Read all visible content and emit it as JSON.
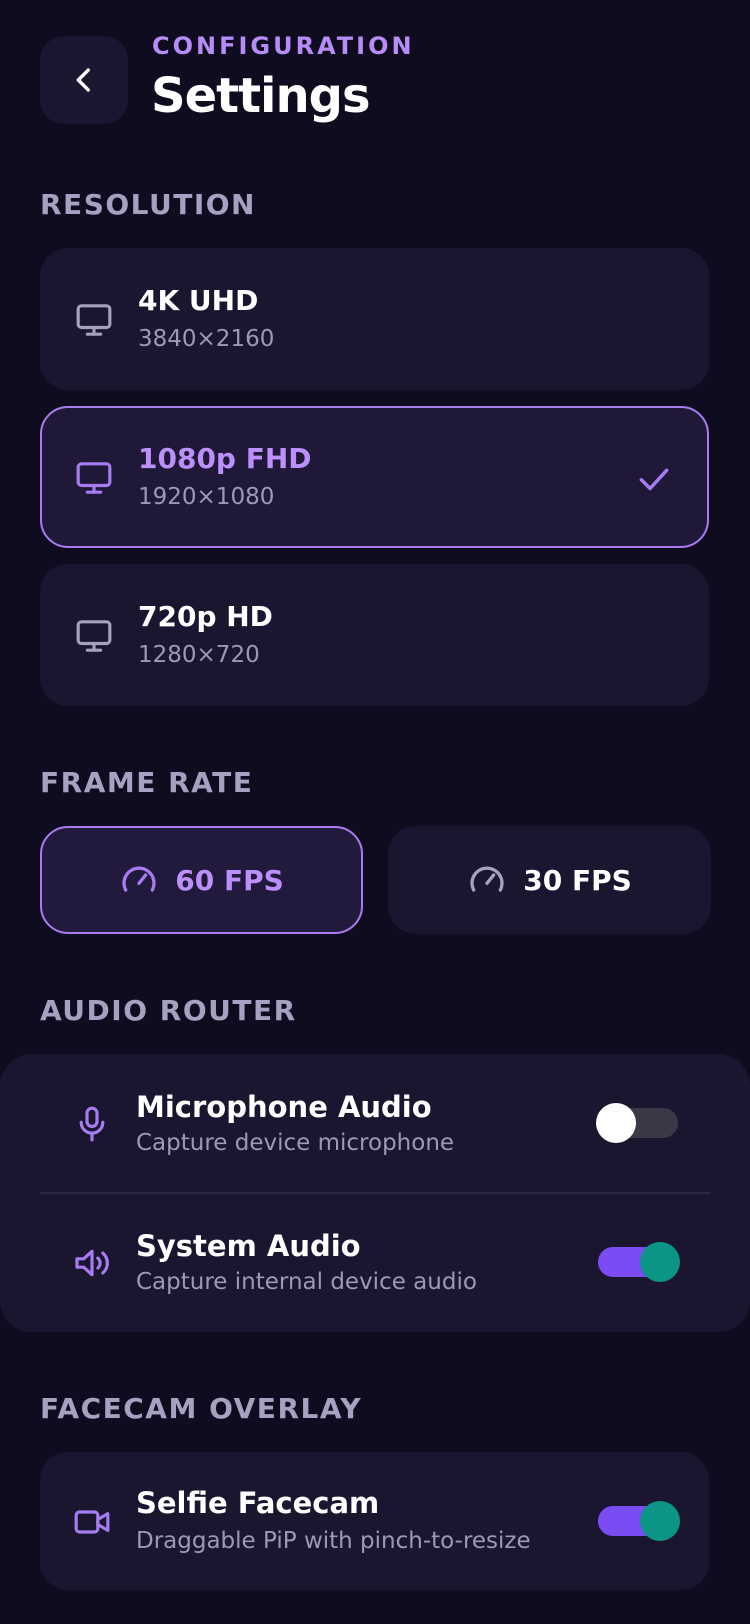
{
  "header": {
    "eyebrow": "CONFIGURATION",
    "title": "Settings",
    "back_icon": "chevron-left-icon"
  },
  "resolution": {
    "label": "RESOLUTION",
    "options": [
      {
        "name": "4K UHD",
        "size": "3840×2160",
        "selected": false,
        "icon": "monitor-icon"
      },
      {
        "name": "1080p FHD",
        "size": "1920×1080",
        "selected": true,
        "icon": "monitor-icon"
      },
      {
        "name": "720p HD",
        "size": "1280×720",
        "selected": false,
        "icon": "monitor-icon"
      }
    ]
  },
  "frame_rate": {
    "label": "FRAME RATE",
    "options": [
      {
        "label": "60 FPS",
        "selected": true,
        "icon": "gauge-icon"
      },
      {
        "label": "30 FPS",
        "selected": false,
        "icon": "gauge-icon"
      }
    ]
  },
  "audio_router": {
    "label": "AUDIO ROUTER",
    "items": [
      {
        "title": "Microphone Audio",
        "subtitle": "Capture device microphone",
        "enabled": false,
        "icon": "microphone-icon"
      },
      {
        "title": "System Audio",
        "subtitle": "Capture internal device audio",
        "enabled": true,
        "icon": "speaker-icon"
      }
    ]
  },
  "facecam": {
    "label": "FACECAM OVERLAY",
    "title": "Selfie Facecam",
    "subtitle": "Draggable PiP with pinch-to-resize",
    "enabled": true,
    "icon": "video-camera-icon"
  },
  "colors": {
    "background": "#100c20",
    "card": "#1b1630",
    "accent": "#a77cf0",
    "toggle_on_track": "#7a4cf3",
    "toggle_on_knob": "#0c9584"
  }
}
